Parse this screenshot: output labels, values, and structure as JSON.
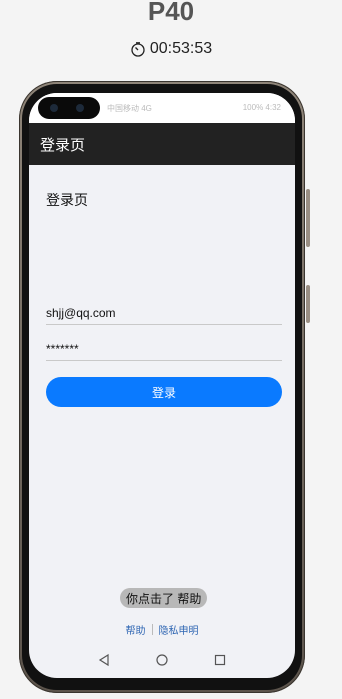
{
  "device": {
    "name": "P40"
  },
  "timer": {
    "icon": "timer-icon",
    "value": "00:53:53"
  },
  "status_bar": {
    "left": "中国移动 4G",
    "right": "100% 4:32"
  },
  "app_bar": {
    "title": "登录页"
  },
  "page": {
    "heading": "登录页"
  },
  "form": {
    "email_value": "shjj@qq.com",
    "password_value": "*******",
    "login_label": "登录"
  },
  "toast": {
    "text": "你点击了 帮助"
  },
  "footer": {
    "help_label": "帮助",
    "privacy_label": "隐私申明"
  },
  "nav": {
    "back_icon": "back-triangle-icon",
    "home_icon": "home-circle-icon",
    "recents_icon": "recents-square-icon"
  },
  "colors": {
    "primary": "#0a7aff",
    "app_bar": "#222222",
    "link": "#2f66b3"
  }
}
